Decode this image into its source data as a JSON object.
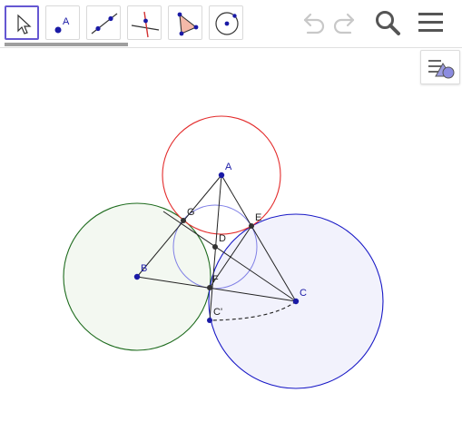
{
  "toolbar": {
    "tools": [
      {
        "name": "move-tool",
        "icon": "arrow-cursor-icon",
        "selected": true
      },
      {
        "name": "point-tool",
        "icon": "point-icon",
        "label": "A"
      },
      {
        "name": "line-tool",
        "icon": "line-through-two-points-icon"
      },
      {
        "name": "perpendicular-tool",
        "icon": "perpendicular-line-icon"
      },
      {
        "name": "polygon-tool",
        "icon": "polygon-icon"
      },
      {
        "name": "circle-tool",
        "icon": "circle-with-center-icon"
      }
    ],
    "undo_icon": "undo-icon",
    "redo_icon": "redo-icon",
    "search_icon": "search-icon",
    "menu_icon": "hamburger-menu-icon",
    "style_bar_icon": "graphics-style-bar-icon"
  },
  "colors": {
    "accent": "#6557d2",
    "point": "#1a1aa6",
    "circle_red": "#e32b2b",
    "circle_green": "#1d6b1d",
    "circle_green_fill": "#f1f7ee",
    "circle_blue": "#1919c6",
    "circle_blue_fill": "#f0f0fc",
    "circle_small": "#8080e6"
  },
  "points": {
    "A": "A",
    "B": "B",
    "C": "C",
    "D": "D",
    "E": "E",
    "F": "F",
    "G": "G",
    "C_prime": "C'"
  }
}
